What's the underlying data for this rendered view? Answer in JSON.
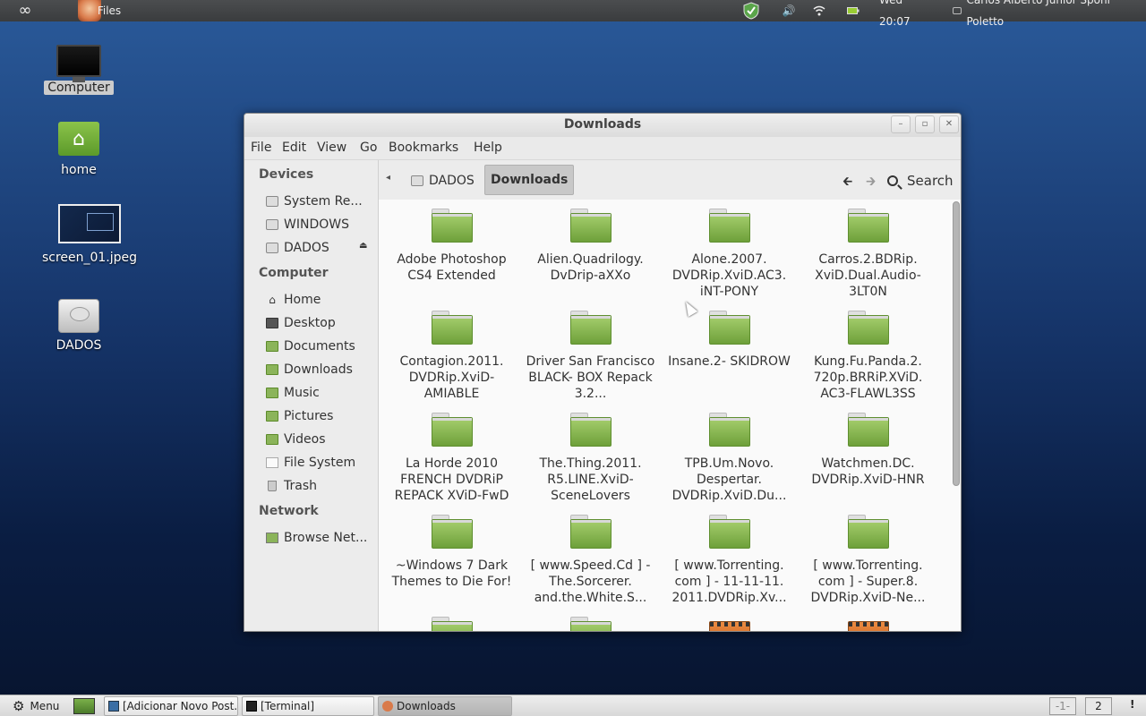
{
  "top_panel": {
    "app_label": "Files",
    "clock": "Wed 20:07",
    "user": "Carlos Alberto Junior Spohr Poletto",
    "icons": [
      "infinity-icon",
      "files-app-icon",
      "shield-icon",
      "volume-icon",
      "wifi-icon",
      "battery-icon",
      "user-icon"
    ]
  },
  "desktop": {
    "icons": [
      {
        "label": "Computer"
      },
      {
        "label": "home"
      },
      {
        "label": "screen_01.jpeg"
      },
      {
        "label": "DADOS"
      }
    ]
  },
  "window": {
    "title": "Downloads",
    "menu": [
      "File",
      "Edit",
      "View",
      "Go",
      "Bookmarks",
      "Help"
    ],
    "sidebar": {
      "devices_heading": "Devices",
      "devices": [
        "System Re...",
        "WINDOWS",
        "DADOS"
      ],
      "computer_heading": "Computer",
      "computer": [
        "Home",
        "Desktop",
        "Documents",
        "Downloads",
        "Music",
        "Pictures",
        "Videos",
        "File System",
        "Trash"
      ],
      "network_heading": "Network",
      "network": [
        "Browse Net..."
      ]
    },
    "pathbar": {
      "segments": [
        "DADOS",
        "Downloads"
      ],
      "search_label": "Search"
    },
    "files": [
      {
        "name": "Adobe Photoshop CS4 Extended",
        "type": "folder"
      },
      {
        "name": "Alien.Quadrilogy. DvDrip-aXXo",
        "type": "folder"
      },
      {
        "name": "Alone.2007. DVDRip.XviD.AC3. iNT-PONY",
        "type": "folder"
      },
      {
        "name": "Carros.2.BDRip. XviD.Dual.Audio- 3LT0N",
        "type": "folder"
      },
      {
        "name": "Contagion.2011. DVDRip.XviD- AMIABLE",
        "type": "folder"
      },
      {
        "name": "Driver San Francisco BLACK- BOX Repack 3.2...",
        "type": "folder"
      },
      {
        "name": "Insane.2- SKIDROW",
        "type": "folder"
      },
      {
        "name": "Kung.Fu.Panda.2. 720p.BRRiP.XViD. AC3-FLAWL3SS",
        "type": "folder"
      },
      {
        "name": "La Horde 2010 FRENCH DVDRiP REPACK XViD-FwD",
        "type": "folder"
      },
      {
        "name": "The.Thing.2011. R5.LINE.XviD- SceneLovers",
        "type": "folder"
      },
      {
        "name": "TPB.Um.Novo. Despertar. DVDRip.XviD.Du...",
        "type": "folder"
      },
      {
        "name": "Watchmen.DC. DVDRip.XviD-HNR",
        "type": "folder"
      },
      {
        "name": "~Windows 7 Dark Themes to Die For!",
        "type": "folder"
      },
      {
        "name": "[ www.Speed.Cd ] - The.Sorcerer. and.the.White.S...",
        "type": "folder"
      },
      {
        "name": "[ www.Torrenting. com ] - 11-11-11. 2011.DVDRip.Xv...",
        "type": "folder"
      },
      {
        "name": "[ www.Torrenting. com ] - Super.8. DVDRip.XviD-Ne...",
        "type": "folder"
      },
      {
        "name": "",
        "type": "folder"
      },
      {
        "name": "",
        "type": "folder"
      },
      {
        "name": "",
        "type": "video"
      },
      {
        "name": "",
        "type": "video"
      }
    ]
  },
  "taskbar": {
    "menu_label": "Menu",
    "tasks": [
      "[Adicionar Novo Post...",
      "[Terminal]",
      "Downloads"
    ],
    "workspaces": [
      "-1-",
      "2"
    ],
    "alert": "!"
  }
}
